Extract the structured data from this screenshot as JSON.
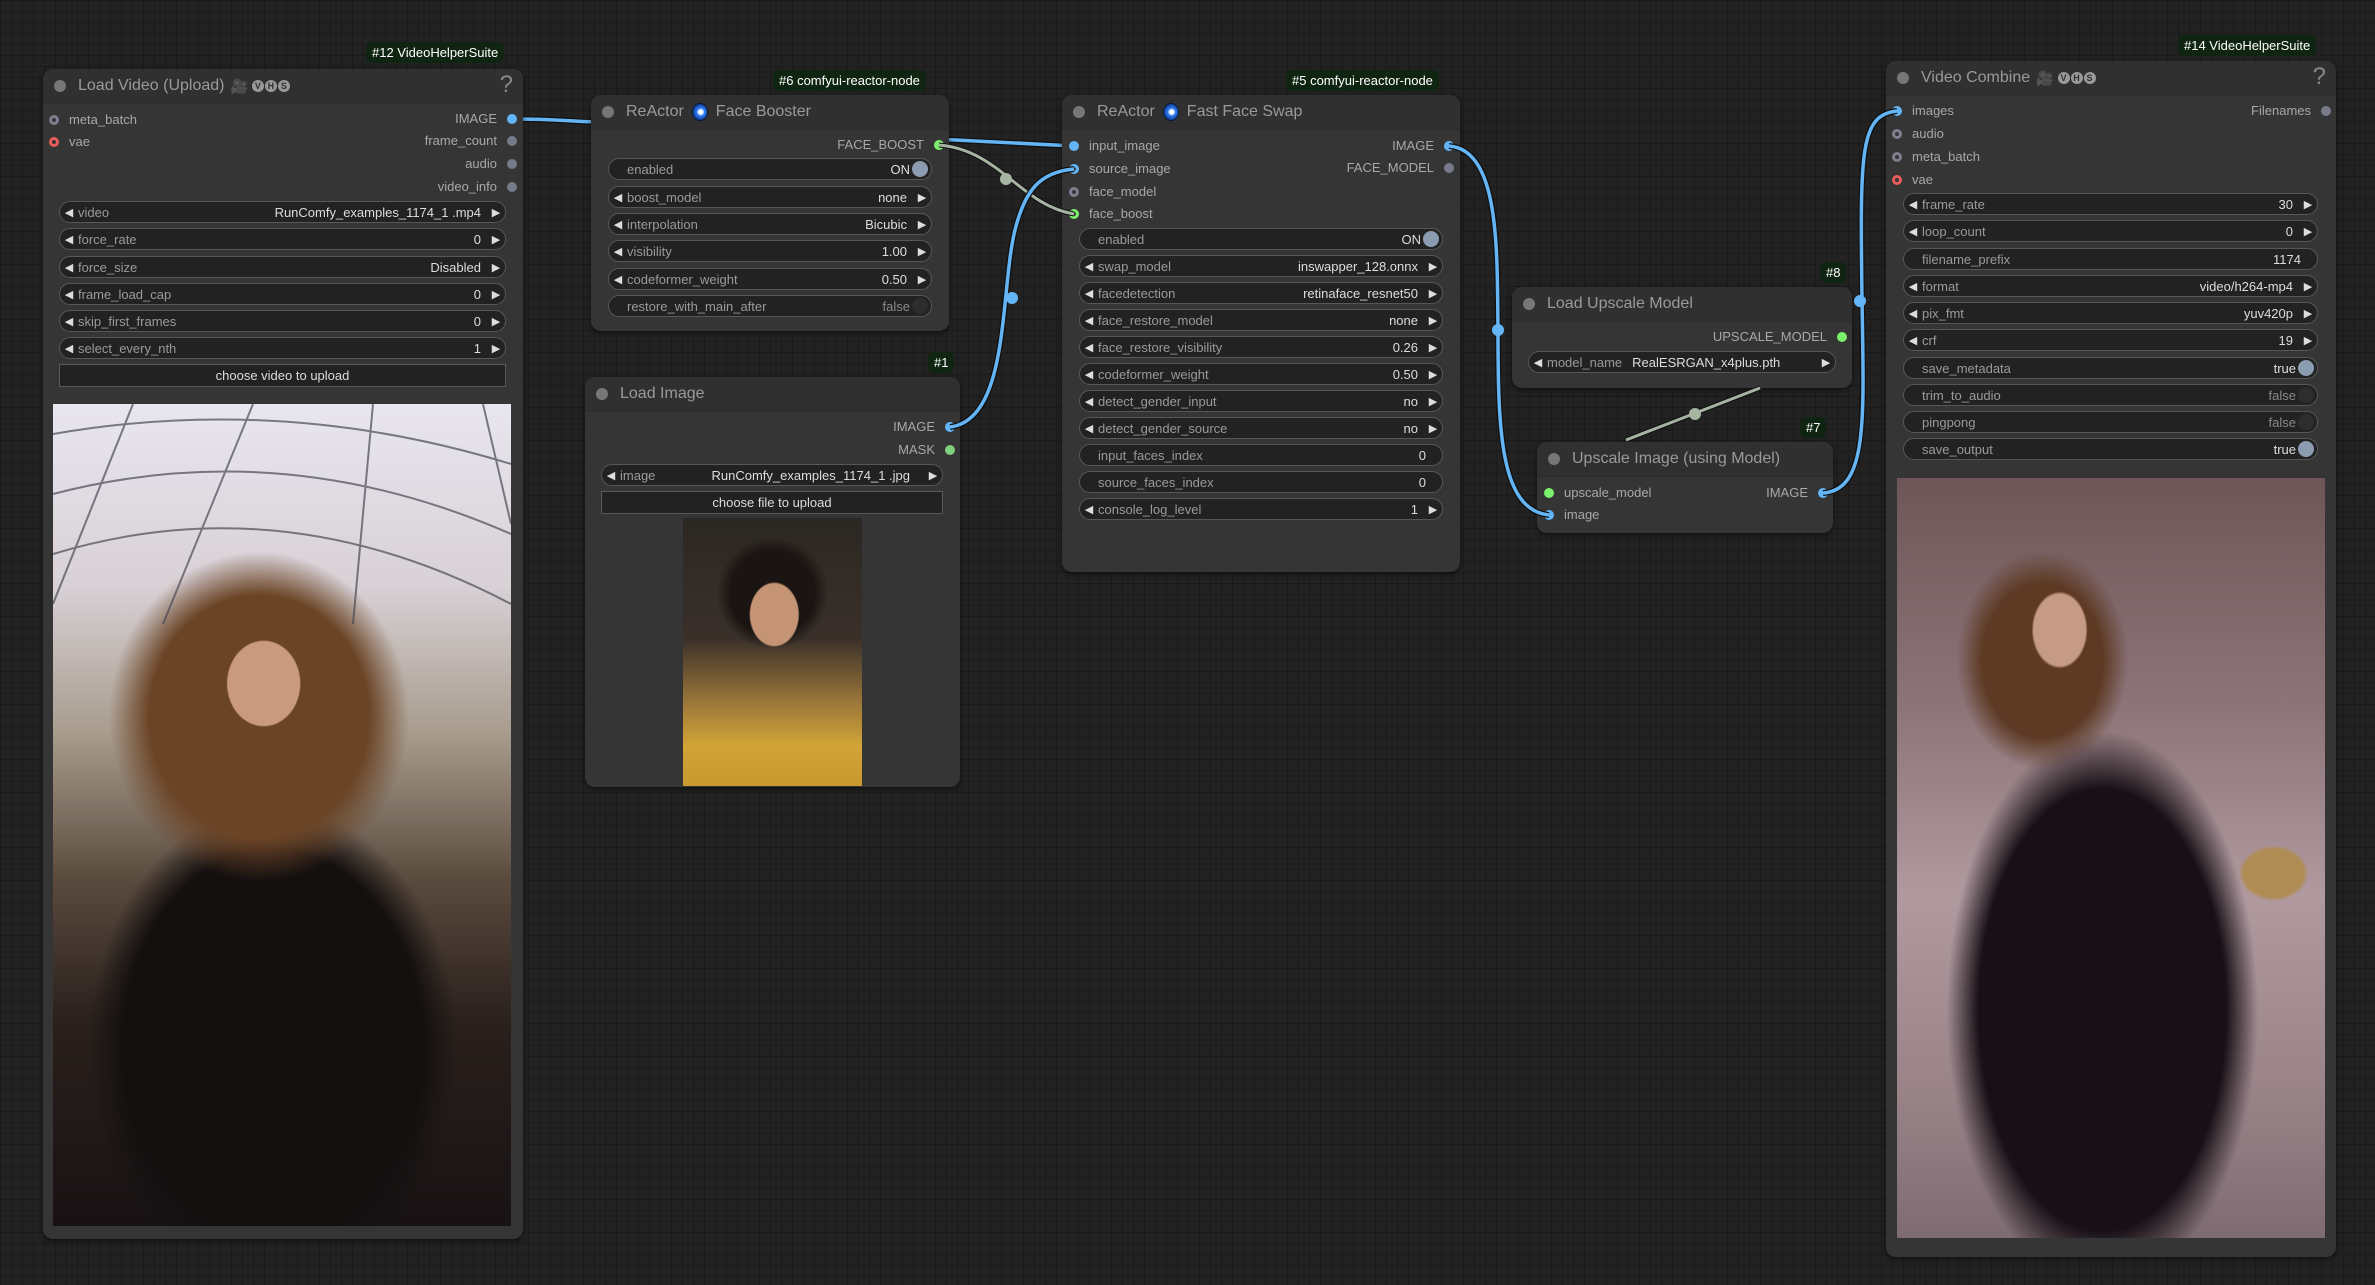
{
  "canvas": {
    "wire_colors": {
      "image": "#64b5f6",
      "face_boost": "#a5b5a2",
      "upscale_model": "#a5b5a2"
    }
  },
  "nodes": {
    "load_video": {
      "tag": "#12 VideoHelperSuite",
      "title": "Load Video (Upload)",
      "badges": [
        "V",
        "H",
        "S"
      ],
      "help": "?",
      "inputs": [
        "meta_batch",
        "vae"
      ],
      "outputs": [
        "IMAGE",
        "frame_count",
        "audio",
        "video_info"
      ],
      "widgets": [
        {
          "label": "video",
          "value": "RunComfy_examples_1174_1 .mp4"
        },
        {
          "label": "force_rate",
          "value": "0"
        },
        {
          "label": "force_size",
          "value": "Disabled"
        },
        {
          "label": "frame_load_cap",
          "value": "0"
        },
        {
          "label": "skip_first_frames",
          "value": "0"
        },
        {
          "label": "select_every_nth",
          "value": "1"
        }
      ],
      "upload_button": "choose video to upload",
      "preview": "video preview: woman with curly hair in black dress under glass dome"
    },
    "face_booster": {
      "tag": "#6 comfyui-reactor-node",
      "title_prefix": "ReActor",
      "title": "Face Booster",
      "outputs": [
        "FACE_BOOST"
      ],
      "widgets": [
        {
          "label": "enabled",
          "value": "ON",
          "type": "toggle",
          "on": true
        },
        {
          "label": "boost_model",
          "value": "none",
          "type": "combo"
        },
        {
          "label": "interpolation",
          "value": "Bicubic",
          "type": "combo"
        },
        {
          "label": "visibility",
          "value": "1.00",
          "type": "number"
        },
        {
          "label": "codeformer_weight",
          "value": "0.50",
          "type": "number"
        },
        {
          "label": "restore_with_main_after",
          "value": "false",
          "type": "toggle",
          "on": false
        }
      ]
    },
    "load_image": {
      "tag": "#1",
      "title": "Load Image",
      "outputs": [
        "IMAGE",
        "MASK"
      ],
      "widgets": [
        {
          "label": "image",
          "value": "RunComfy_examples_1174_1 .jpg"
        }
      ],
      "upload_button": "choose file to upload",
      "preview": "image preview: woman with dark hair in yellow lace top"
    },
    "fast_face_swap": {
      "tag": "#5 comfyui-reactor-node",
      "title_prefix": "ReActor",
      "title": "Fast Face Swap",
      "inputs": [
        "input_image",
        "source_image",
        "face_model",
        "face_boost"
      ],
      "outputs": [
        "IMAGE",
        "FACE_MODEL"
      ],
      "widgets": [
        {
          "label": "enabled",
          "value": "ON",
          "type": "toggle",
          "on": true
        },
        {
          "label": "swap_model",
          "value": "inswapper_128.onnx",
          "type": "combo"
        },
        {
          "label": "facedetection",
          "value": "retinaface_resnet50",
          "type": "combo"
        },
        {
          "label": "face_restore_model",
          "value": "none",
          "type": "combo"
        },
        {
          "label": "face_restore_visibility",
          "value": "0.26",
          "type": "number"
        },
        {
          "label": "codeformer_weight",
          "value": "0.50",
          "type": "number"
        },
        {
          "label": "detect_gender_input",
          "value": "no",
          "type": "combo"
        },
        {
          "label": "detect_gender_source",
          "value": "no",
          "type": "combo"
        },
        {
          "label": "input_faces_index",
          "value": "0",
          "type": "text"
        },
        {
          "label": "source_faces_index",
          "value": "0",
          "type": "text"
        },
        {
          "label": "console_log_level",
          "value": "1",
          "type": "combo"
        }
      ]
    },
    "load_upscale_model": {
      "tag": "#8",
      "title": "Load Upscale Model",
      "outputs": [
        "UPSCALE_MODEL"
      ],
      "widgets": [
        {
          "label": "model_name",
          "value": "RealESRGAN_x4plus.pth"
        }
      ]
    },
    "upscale_image": {
      "tag": "#7",
      "title": "Upscale Image (using Model)",
      "inputs": [
        "upscale_model",
        "image"
      ],
      "outputs": [
        "IMAGE"
      ]
    },
    "video_combine": {
      "tag": "#14 VideoHelperSuite",
      "title": "Video Combine",
      "badges": [
        "V",
        "H",
        "S"
      ],
      "help": "?",
      "inputs": [
        "images",
        "audio",
        "meta_batch",
        "vae"
      ],
      "outputs": [
        "Filenames"
      ],
      "widgets": [
        {
          "label": "frame_rate",
          "value": "30",
          "type": "number"
        },
        {
          "label": "loop_count",
          "value": "0",
          "type": "number"
        },
        {
          "label": "filename_prefix",
          "value": "1174",
          "type": "text"
        },
        {
          "label": "format",
          "value": "video/h264-mp4",
          "type": "combo"
        },
        {
          "label": "pix_fmt",
          "value": "yuv420p",
          "type": "combo"
        },
        {
          "label": "crf",
          "value": "19",
          "type": "number"
        },
        {
          "label": "save_metadata",
          "value": "true",
          "type": "toggle",
          "on": true
        },
        {
          "label": "trim_to_audio",
          "value": "false",
          "type": "toggle",
          "on": false
        },
        {
          "label": "pingpong",
          "value": "false",
          "type": "toggle",
          "on": false
        },
        {
          "label": "save_output",
          "value": "true",
          "type": "toggle",
          "on": true
        }
      ],
      "preview": "output video preview: woman with curly hair in black dress, posed"
    }
  }
}
